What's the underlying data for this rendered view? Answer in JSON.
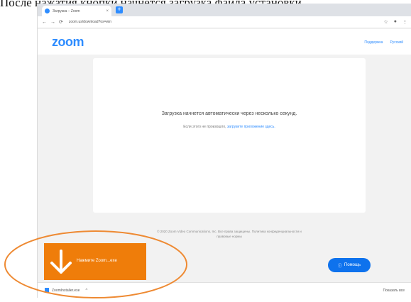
{
  "caption": "После нажатия кнопки начнется загрузка файла установки",
  "browser": {
    "tab_title": "Загрузка – Zoom",
    "tab_close": "×",
    "new_tab": "+",
    "url": "zoom.us/download?os=win",
    "nav": [
      "←",
      "→",
      "⟳"
    ]
  },
  "zoom": {
    "logo": "zoom",
    "links": [
      "Поддержка",
      "Русский"
    ]
  },
  "card": {
    "message": "Загрузка начнется автоматически через несколько секунд.",
    "sub_prefix": "Если этого не произошло,",
    "sub_link": "загрузите приложение здесь."
  },
  "footer": "© 2020 Zoom Video Communications, Inc. Все права защищены. Политика конфиденциальности и правовые нормы",
  "help_label": "Помощь",
  "download": {
    "file": "ZoomInstaller.exe",
    "chevron": "^",
    "show_all": "Показать все",
    "callout": "Нажмите Zoom...exe"
  },
  "colors": {
    "accent": "#2d8cff",
    "orange": "#ef7d0a",
    "help": "#0e72ed"
  }
}
